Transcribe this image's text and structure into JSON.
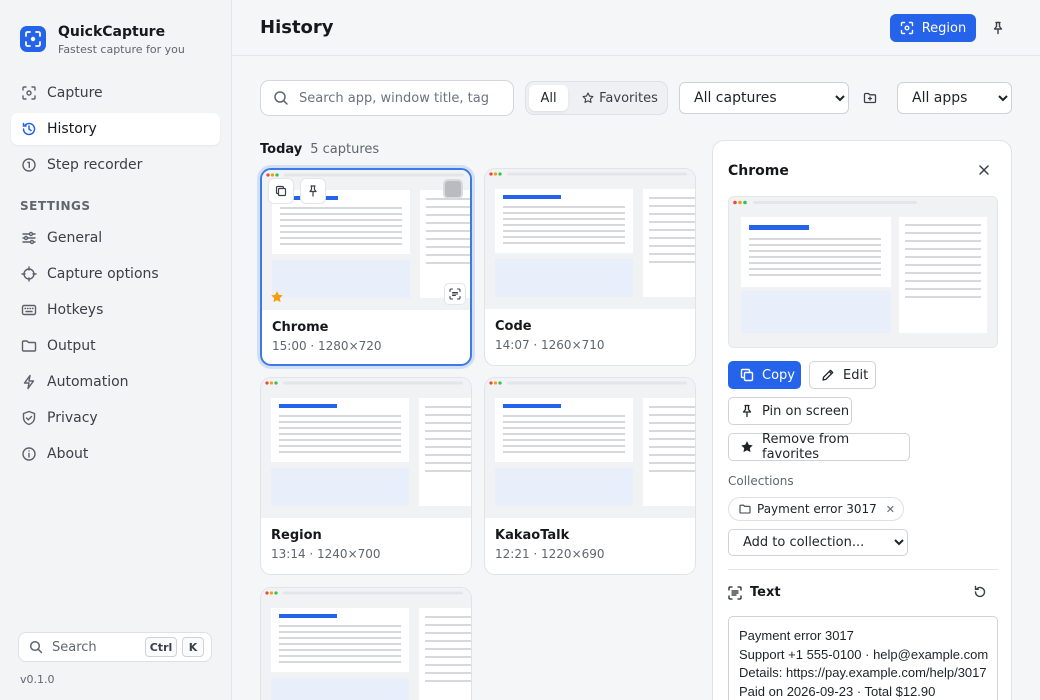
{
  "app": {
    "name": "QuickCapture",
    "tagline": "Fastest capture for you",
    "version": "v0.1.0"
  },
  "sidebar": {
    "items": [
      {
        "label": "Capture",
        "icon": "capture-icon"
      },
      {
        "label": "History",
        "icon": "history-icon",
        "active": true
      },
      {
        "label": "Step recorder",
        "icon": "step-recorder-icon"
      }
    ],
    "settings_label": "SETTINGS",
    "settings_items": [
      {
        "label": "General",
        "icon": "sliders-icon"
      },
      {
        "label": "Capture options",
        "icon": "crosshair-icon"
      },
      {
        "label": "Hotkeys",
        "icon": "keyboard-icon"
      },
      {
        "label": "Output",
        "icon": "folder-icon"
      },
      {
        "label": "Automation",
        "icon": "bolt-icon"
      },
      {
        "label": "Privacy",
        "icon": "shield-icon"
      },
      {
        "label": "About",
        "icon": "info-icon"
      }
    ],
    "search": {
      "label": "Search",
      "keys": [
        "Ctrl",
        "K"
      ]
    }
  },
  "header": {
    "title": "History",
    "region_label": "Region"
  },
  "toolbar": {
    "search_placeholder": "Search app, window title, tag",
    "filter_all": "All",
    "filter_favorites": "Favorites",
    "captures_select": "All captures",
    "apps_select": "All apps"
  },
  "group": {
    "label": "Today",
    "count": "5 captures"
  },
  "cards": [
    {
      "title": "Chrome",
      "meta": "15:00 · 1280×720",
      "selected": true,
      "favorite": true
    },
    {
      "title": "Code",
      "meta": "14:07 · 1260×710"
    },
    {
      "title": "Region",
      "meta": "13:14 · 1240×700"
    },
    {
      "title": "KakaoTalk",
      "meta": "12:21 · 1220×690"
    },
    {
      "title": "",
      "meta": ""
    }
  ],
  "detail": {
    "title": "Chrome",
    "copy_label": "Copy",
    "edit_label": "Edit",
    "pin_label": "Pin on screen",
    "favorite_label": "Remove from favorites",
    "collections_label": "Collections",
    "collection_chip": "Payment error 3017",
    "add_collection": "Add to collection...",
    "text_label": "Text",
    "ocr_text": "Payment error 3017\nSupport +1 555-0100 · help@example.com\nDetails: https://pay.example.com/help/3017\nPaid on 2026-09-23 · Total $12.90"
  },
  "colors": {
    "accent": "#2563eb",
    "star": "#f59e0b"
  }
}
